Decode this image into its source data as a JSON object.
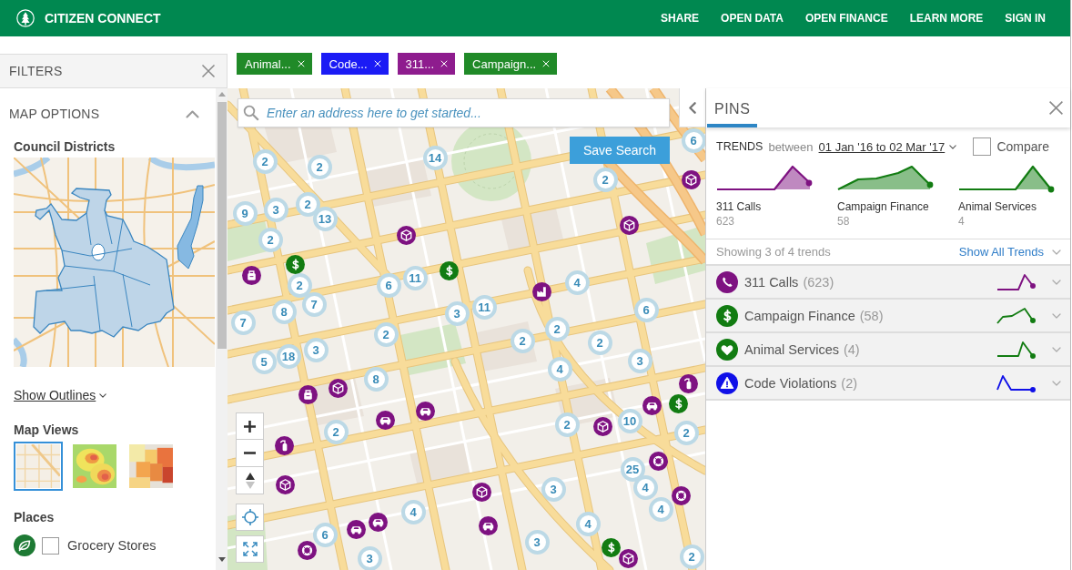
{
  "header": {
    "title": "CITIZEN CONNECT",
    "nav": [
      "SHARE",
      "OPEN DATA",
      "OPEN FINANCE",
      "LEARN MORE",
      "SIGN IN"
    ]
  },
  "filter_tags": [
    {
      "label": "Animal...",
      "color": "#208a28"
    },
    {
      "label": "Code...",
      "color": "#1b1bf5"
    },
    {
      "label": "311...",
      "color": "#8e1c8e"
    },
    {
      "label": "Campaign...",
      "color": "#208a28"
    }
  ],
  "filters_panel": {
    "title": "FILTERS",
    "section": {
      "title": "MAP OPTIONS",
      "expanded": true
    },
    "districts_title": "Council Districts",
    "outlines_link": "Show Outlines",
    "map_views": {
      "title": "Map Views",
      "items": [
        {
          "kind": "street",
          "selected": true
        },
        {
          "kind": "heat",
          "selected": false
        },
        {
          "kind": "choropleth",
          "selected": false
        }
      ]
    },
    "places": {
      "title": "Places",
      "items": [
        {
          "label": "Grocery Stores",
          "checked": false,
          "color": "#1e7a34"
        }
      ]
    }
  },
  "map": {
    "search": {
      "placeholder": "Enter an address here to get started..."
    },
    "save_button": "Save Search",
    "clusters": [
      {
        "count": "2"
      },
      {
        "count": "2"
      },
      {
        "count": "14"
      },
      {
        "count": "2"
      },
      {
        "count": "6"
      },
      {
        "count": "9"
      },
      {
        "count": "3"
      },
      {
        "count": "2"
      },
      {
        "count": "13"
      },
      {
        "count": "2"
      },
      {
        "count": "2"
      },
      {
        "count": "6"
      },
      {
        "count": "11"
      },
      {
        "count": "4"
      },
      {
        "count": "7"
      },
      {
        "count": "8"
      },
      {
        "count": "7"
      },
      {
        "count": "3"
      },
      {
        "count": "11"
      },
      {
        "count": "6"
      },
      {
        "count": "2"
      },
      {
        "count": "2"
      },
      {
        "count": "2"
      },
      {
        "count": "2"
      },
      {
        "count": "3"
      },
      {
        "count": "18"
      },
      {
        "count": "5"
      },
      {
        "count": "3"
      },
      {
        "count": "4"
      },
      {
        "count": "8"
      },
      {
        "count": "2"
      },
      {
        "count": "2"
      },
      {
        "count": "10"
      },
      {
        "count": "2"
      },
      {
        "count": "25"
      },
      {
        "count": "4"
      },
      {
        "count": "3"
      },
      {
        "count": "4"
      },
      {
        "count": "4"
      },
      {
        "count": "6"
      },
      {
        "count": "4"
      },
      {
        "count": "3"
      },
      {
        "count": "3"
      },
      {
        "count": "2"
      }
    ],
    "pins": [
      {
        "kind": "cube",
        "color": "#7e1281"
      },
      {
        "kind": "cube",
        "color": "#7e1281"
      },
      {
        "kind": "cube",
        "color": "#7e1281"
      },
      {
        "kind": "dollar",
        "color": "#127c12"
      },
      {
        "kind": "dollar",
        "color": "#127c12"
      },
      {
        "kind": "bag",
        "color": "#7e1281"
      },
      {
        "kind": "factory",
        "color": "#7e1281"
      },
      {
        "kind": "extinguisher",
        "color": "#7e1281"
      },
      {
        "kind": "dollar",
        "color": "#127c12"
      },
      {
        "kind": "car",
        "color": "#7e1281"
      },
      {
        "kind": "bag",
        "color": "#7e1281"
      },
      {
        "kind": "cube",
        "color": "#7e1281"
      },
      {
        "kind": "car",
        "color": "#7e1281"
      },
      {
        "kind": "car",
        "color": "#7e1281"
      },
      {
        "kind": "cube",
        "color": "#7e1281"
      },
      {
        "kind": "extinguisher",
        "color": "#7e1281"
      },
      {
        "kind": "ring",
        "color": "#7e1281"
      },
      {
        "kind": "cube",
        "color": "#7e1281"
      },
      {
        "kind": "cube",
        "color": "#7e1281"
      },
      {
        "kind": "ring",
        "color": "#7e1281"
      },
      {
        "kind": "car",
        "color": "#7e1281"
      },
      {
        "kind": "car",
        "color": "#7e1281"
      },
      {
        "kind": "car",
        "color": "#7e1281"
      },
      {
        "kind": "ring",
        "color": "#7e1281"
      },
      {
        "kind": "dollar",
        "color": "#127c12"
      },
      {
        "kind": "cube",
        "color": "#7e1281"
      }
    ]
  },
  "pins_panel": {
    "tabs": [
      {
        "label": "PINS",
        "selected": true
      }
    ],
    "trends_label": "TRENDS",
    "between": "between",
    "date_range": "01 Jan '16 to 02 Mar '17",
    "compare": {
      "label": "Compare",
      "checked": false
    },
    "cards": [
      {
        "name": "311 Calls",
        "count": "623",
        "color": "#7e1281"
      },
      {
        "name": "Campaign Finance",
        "count": "58",
        "color": "#127c12"
      },
      {
        "name": "Animal Services",
        "count": "4",
        "color": "#127c12"
      }
    ],
    "showing": "Showing 3 of 4 trends",
    "show_all": "Show All Trends",
    "categories": [
      {
        "kind": "phone",
        "name": "311 Calls",
        "count": "(623)",
        "color": "#7e1281"
      },
      {
        "kind": "dollar",
        "name": "Campaign Finance",
        "count": "(58)",
        "color": "#127c12"
      },
      {
        "kind": "heart",
        "name": "Animal Services",
        "count": "(4)",
        "color": "#127c12"
      },
      {
        "kind": "warning",
        "name": "Code Violations",
        "count": "(2)",
        "color": "#1010e8"
      }
    ]
  }
}
